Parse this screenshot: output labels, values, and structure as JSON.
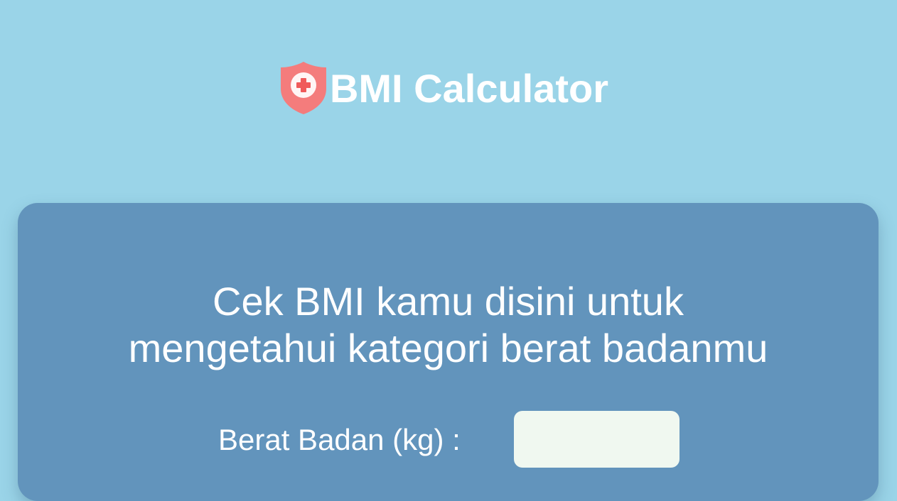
{
  "header": {
    "logo_icon": "shield-medical-icon",
    "title": "BMI Calculator"
  },
  "card": {
    "headline_line1": "Cek BMI kamu disini untuk",
    "headline_line2": "mengetahui kategori berat badanmu",
    "weight_label": "Berat Badan (kg) :",
    "weight_value": ""
  },
  "colors": {
    "background": "#9ad4e8",
    "card": "#6294bc",
    "shield": "#f08080",
    "input_bg": "#f0f8f0"
  }
}
